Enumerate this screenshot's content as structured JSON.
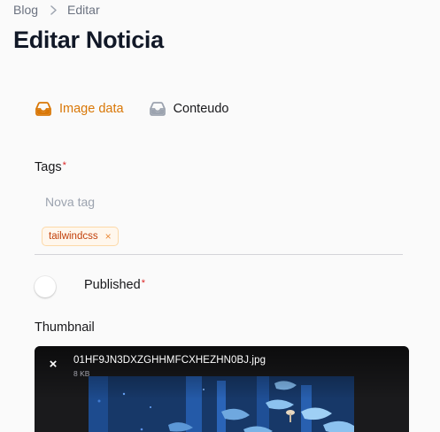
{
  "breadcrumb": {
    "parent": "Blog",
    "current": "Editar"
  },
  "page_title": "Editar Noticia",
  "tabs": [
    {
      "label": "Image data",
      "icon": "inbox-icon",
      "active": true
    },
    {
      "label": "Conteudo",
      "icon": "inbox-icon",
      "active": false
    }
  ],
  "tags_field": {
    "label": "Tags",
    "required_mark": "*",
    "placeholder": "Nova tag",
    "value": "",
    "tags": [
      {
        "label": "tailwindcss",
        "remove_symbol": "×"
      }
    ]
  },
  "published_field": {
    "label": "Published",
    "required_mark": "*",
    "checked": false
  },
  "thumbnail_field": {
    "label": "Thumbnail",
    "file_name": "01HF9JN3DXZGHHMFCXHEZHN0BJ.jpg",
    "file_size": "8 KB",
    "remove_symbol": "×"
  },
  "colors": {
    "accent": "#d97706",
    "required": "#dc2626",
    "tag_text": "#c2410c",
    "tag_bg": "#fff7ed"
  }
}
